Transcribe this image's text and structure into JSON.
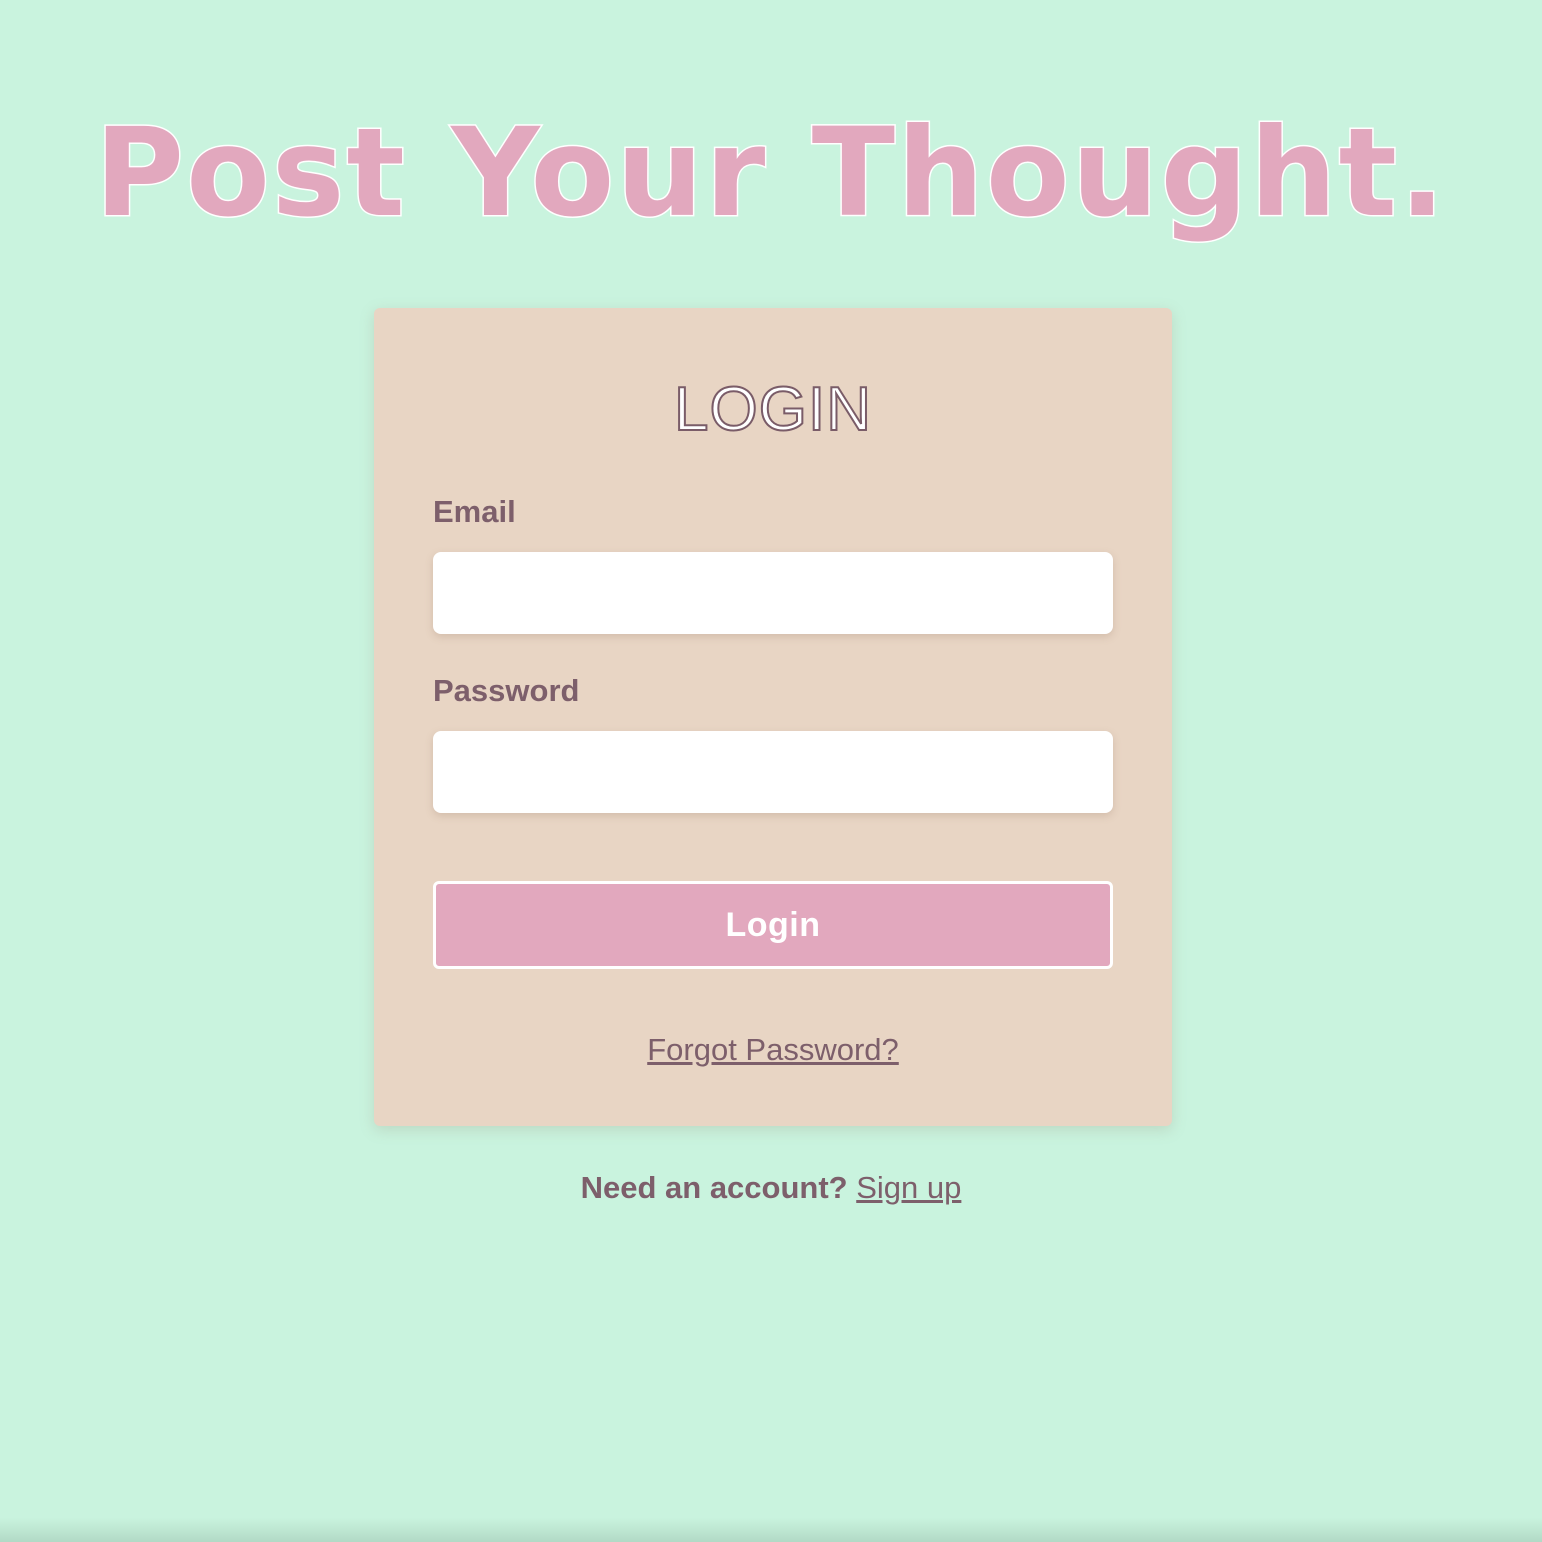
{
  "brand": {
    "title": "Post Your Thought."
  },
  "login_card": {
    "heading": "LOGIN",
    "email_label": "Email",
    "email_value": "",
    "password_label": "Password",
    "password_value": "",
    "submit_label": "Login",
    "forgot_password_label": "Forgot Password?"
  },
  "signup": {
    "prompt": "Need an account?",
    "link_label": "Sign up"
  },
  "colors": {
    "background": "#c9f3de",
    "card": "#e8d5c4",
    "accent_pink": "#e2a8be",
    "text_mauve": "#7d5f6b"
  }
}
